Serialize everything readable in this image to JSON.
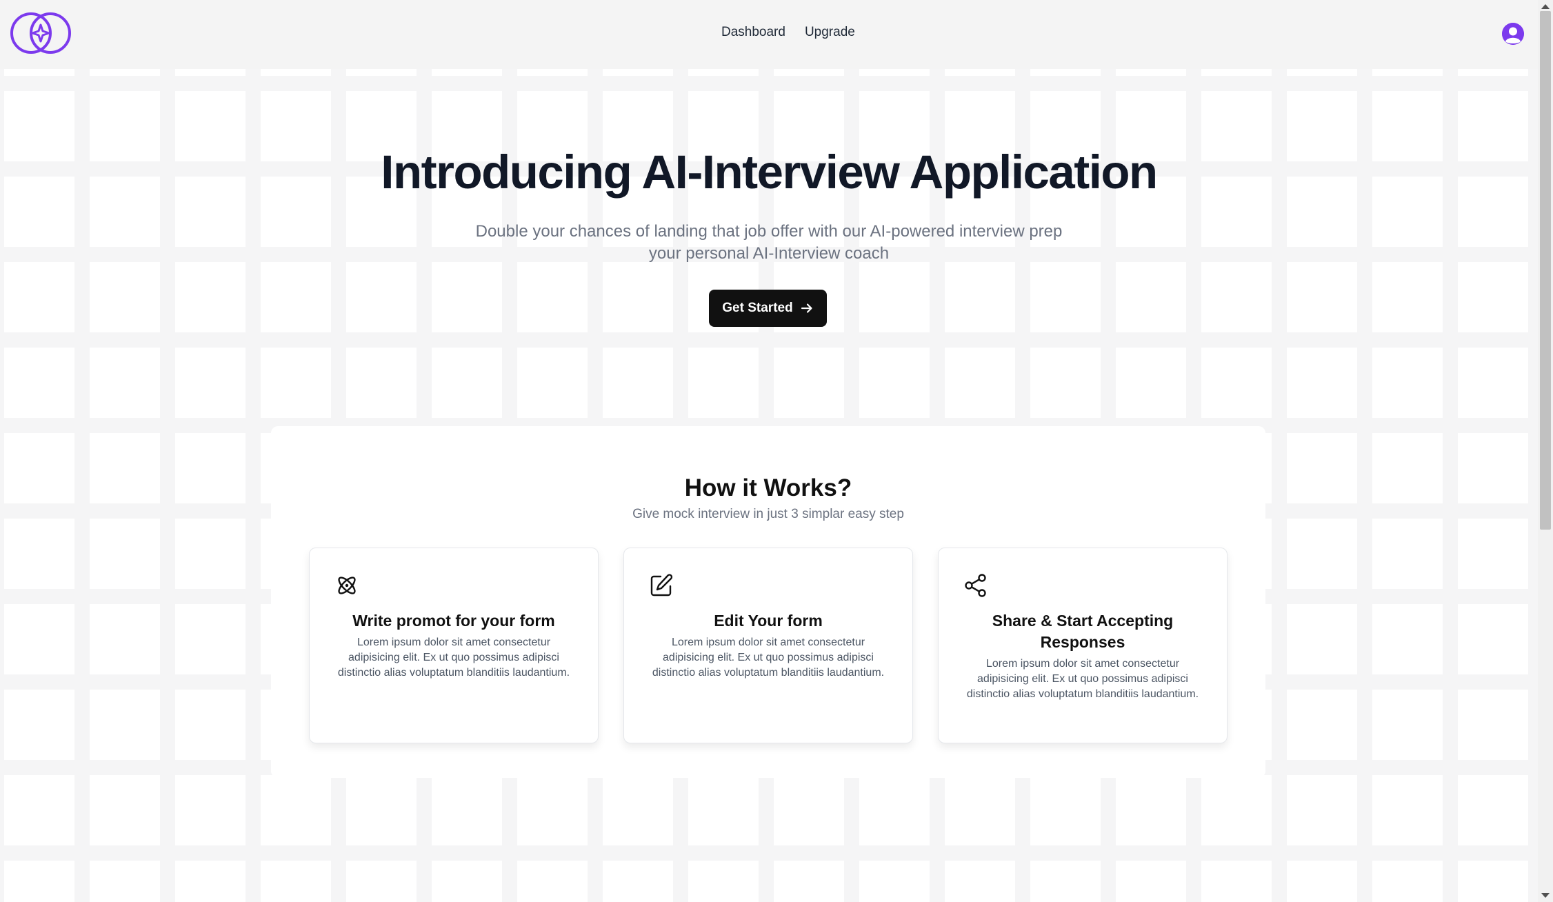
{
  "nav": {
    "items": [
      {
        "label": "Dashboard"
      },
      {
        "label": "Upgrade"
      }
    ]
  },
  "hero": {
    "title": "Introducing AI-Interview Application",
    "subtitle_line1": "Double your chances of landing that job offer with our AI-powered interview prep",
    "subtitle_line2": "your personal AI-Interview coach",
    "cta_label": "Get Started"
  },
  "how": {
    "title": "How it Works?",
    "subtitle": "Give mock interview in just 3 simplar easy step",
    "cards": [
      {
        "title": "Write promot for your form",
        "description": "Lorem ipsum dolor sit amet consectetur adipisicing elit. Ex ut quo possimus adipisci distinctio alias voluptatum blanditiis laudantium.",
        "icon": "atom-icon"
      },
      {
        "title": "Edit Your form",
        "description": "Lorem ipsum dolor sit amet consectetur adipisicing elit. Ex ut quo possimus adipisci distinctio alias voluptatum blanditiis laudantium.",
        "icon": "edit-icon"
      },
      {
        "title": "Share & Start Accepting Responses",
        "description": "Lorem ipsum dolor sit amet consectetur adipisicing elit. Ex ut quo possimus adipisci distinctio alias voluptatum blanditiis laudantium.",
        "icon": "share-icon"
      }
    ]
  },
  "colors": {
    "brand": "#7c3aed",
    "button": "#111111",
    "text": "#111827",
    "muted": "#6b7280"
  }
}
